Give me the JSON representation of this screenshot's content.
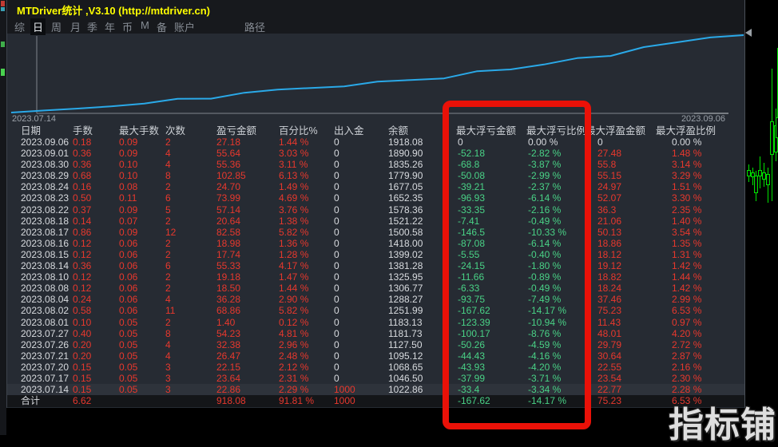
{
  "window": {
    "title": "MTDriver统计 ,V3.10 (http://mtdriver.cn)"
  },
  "menu": {
    "items": [
      "综",
      "日",
      "周",
      "月",
      "季",
      "年",
      "币",
      "M",
      "备",
      "账户",
      "路径"
    ],
    "active": "日"
  },
  "chart_data": {
    "type": "line",
    "x": [
      "2023.07.14",
      "2023.07.17",
      "2023.07.20",
      "2023.07.21",
      "2023.07.26",
      "2023.07.27",
      "2023.08.01",
      "2023.08.02",
      "2023.08.04",
      "2023.08.08",
      "2023.08.10",
      "2023.08.14",
      "2023.08.15",
      "2023.08.16",
      "2023.08.17",
      "2023.08.18",
      "2023.08.22",
      "2023.08.23",
      "2023.08.24",
      "2023.08.29",
      "2023.08.30",
      "2023.09.01",
      "2023.09.06"
    ],
    "y": [
      1022.86,
      1046.5,
      1068.65,
      1095.12,
      1127.5,
      1181.73,
      1183.13,
      1251.99,
      1288.27,
      1306.77,
      1325.95,
      1381.28,
      1399.02,
      1418.0,
      1500.58,
      1521.22,
      1578.36,
      1652.35,
      1677.05,
      1779.9,
      1835.26,
      1890.9,
      1918.08
    ],
    "x_start_label": "2023.07.14",
    "x_end_label": "2023.09.06",
    "ylim": [
      1022.86,
      1918.08
    ],
    "legend": [],
    "grid": false,
    "line_color": "#2aa9e8"
  },
  "table": {
    "headers": [
      "日期",
      "手数",
      "最大手数",
      "次数",
      "盈亏金额",
      "百分比%",
      "出入金",
      "余额",
      "最大浮亏金额",
      "最大浮亏比例",
      "最大浮盈金额",
      "最大浮盈比例"
    ],
    "rows": [
      [
        "2023.09.06",
        "0.18",
        "0.09",
        "2",
        "27.18",
        "1.44 %",
        "0",
        "1918.08",
        "0",
        "0.00 %",
        "0",
        "0.00 %"
      ],
      [
        "2023.09.01",
        "0.36",
        "0.09",
        "4",
        "55.64",
        "3.03 %",
        "0",
        "1890.90",
        "-52.18",
        "-2.82 %",
        "27.48",
        "1.48 %"
      ],
      [
        "2023.08.30",
        "0.36",
        "0.10",
        "4",
        "55.36",
        "3.11 %",
        "0",
        "1835.26",
        "-68.8",
        "-3.87 %",
        "55.8",
        "3.14 %"
      ],
      [
        "2023.08.29",
        "0.68",
        "0.10",
        "8",
        "102.85",
        "6.13 %",
        "0",
        "1779.90",
        "-50.08",
        "-2.99 %",
        "55.15",
        "3.29 %"
      ],
      [
        "2023.08.24",
        "0.16",
        "0.08",
        "2",
        "24.70",
        "1.49 %",
        "0",
        "1677.05",
        "-39.21",
        "-2.37 %",
        "24.97",
        "1.51 %"
      ],
      [
        "2023.08.23",
        "0.50",
        "0.11",
        "6",
        "73.99",
        "4.69 %",
        "0",
        "1652.35",
        "-96.93",
        "-6.14 %",
        "52.07",
        "3.30 %"
      ],
      [
        "2023.08.22",
        "0.37",
        "0.09",
        "5",
        "57.14",
        "3.76 %",
        "0",
        "1578.36",
        "-33.35",
        "-2.16 %",
        "36.3",
        "2.35 %"
      ],
      [
        "2023.08.18",
        "0.14",
        "0.07",
        "2",
        "20.64",
        "1.38 %",
        "0",
        "1521.22",
        "-7.41",
        "-0.49 %",
        "21.06",
        "1.40 %"
      ],
      [
        "2023.08.17",
        "0.86",
        "0.09",
        "12",
        "82.58",
        "5.82 %",
        "0",
        "1500.58",
        "-146.5",
        "-10.33 %",
        "50.13",
        "3.54 %"
      ],
      [
        "2023.08.16",
        "0.12",
        "0.06",
        "2",
        "18.98",
        "1.36 %",
        "0",
        "1418.00",
        "-87.08",
        "-6.14 %",
        "18.86",
        "1.35 %"
      ],
      [
        "2023.08.15",
        "0.12",
        "0.06",
        "2",
        "17.74",
        "1.28 %",
        "0",
        "1399.02",
        "-5.55",
        "-0.40 %",
        "18.12",
        "1.31 %"
      ],
      [
        "2023.08.14",
        "0.36",
        "0.06",
        "6",
        "55.33",
        "4.17 %",
        "0",
        "1381.28",
        "-24.15",
        "-1.80 %",
        "19.12",
        "1.42 %"
      ],
      [
        "2023.08.10",
        "0.12",
        "0.06",
        "2",
        "19.18",
        "1.47 %",
        "0",
        "1325.95",
        "-11.66",
        "-0.89 %",
        "18.82",
        "1.44 %"
      ],
      [
        "2023.08.08",
        "0.12",
        "0.06",
        "2",
        "18.50",
        "1.44 %",
        "0",
        "1306.77",
        "-6.33",
        "-0.49 %",
        "18.24",
        "1.42 %"
      ],
      [
        "2023.08.04",
        "0.24",
        "0.06",
        "4",
        "36.28",
        "2.90 %",
        "0",
        "1288.27",
        "-93.75",
        "-7.49 %",
        "37.46",
        "2.99 %"
      ],
      [
        "2023.08.02",
        "0.58",
        "0.06",
        "11",
        "68.86",
        "5.82 %",
        "0",
        "1251.99",
        "-167.62",
        "-14.17 %",
        "75.23",
        "6.53 %"
      ],
      [
        "2023.08.01",
        "0.10",
        "0.05",
        "2",
        "1.40",
        "0.12 %",
        "0",
        "1183.13",
        "-123.39",
        "-10.94 %",
        "11.43",
        "0.97 %"
      ],
      [
        "2023.07.27",
        "0.40",
        "0.05",
        "8",
        "54.23",
        "4.81 %",
        "0",
        "1181.73",
        "-100.17",
        "-8.76 %",
        "48.01",
        "4.20 %"
      ],
      [
        "2023.07.26",
        "0.20",
        "0.05",
        "4",
        "32.38",
        "2.96 %",
        "0",
        "1127.50",
        "-50.26",
        "-4.59 %",
        "29.79",
        "2.72 %"
      ],
      [
        "2023.07.21",
        "0.20",
        "0.05",
        "4",
        "26.47",
        "2.48 %",
        "0",
        "1095.12",
        "-44.43",
        "-4.16 %",
        "30.64",
        "2.87 %"
      ],
      [
        "2023.07.20",
        "0.15",
        "0.05",
        "3",
        "22.15",
        "2.12 %",
        "0",
        "1068.65",
        "-43.93",
        "-4.20 %",
        "22.55",
        "2.16 %"
      ],
      [
        "2023.07.17",
        "0.15",
        "0.05",
        "3",
        "23.64",
        "2.31 %",
        "0",
        "1046.50",
        "-37.99",
        "-3.71 %",
        "23.54",
        "2.30 %"
      ],
      [
        "2023.07.14",
        "0.15",
        "0.05",
        "3",
        "22.86",
        "2.29 %",
        "1000",
        "1022.86",
        "-33.4",
        "-3.34 %",
        "22.77",
        "2.28 %"
      ]
    ],
    "total": [
      "合计",
      "6.62",
      "",
      "",
      "918.08",
      "91.81 %",
      "1000",
      "",
      "-167.62",
      "-14.17 %",
      "75.23",
      "6.53 %"
    ]
  },
  "annotation": {
    "shape": "rectangle",
    "color": "#ea1108",
    "highlights": [
      "最大浮亏金额",
      "最大浮亏比例"
    ]
  },
  "watermark": "指标铺",
  "colors": {
    "panel_bg": "#262b33",
    "titlebar_bg": "#17191d",
    "title_text": "#ffff00",
    "value_red": "#e8382d",
    "value_green": "#49d286",
    "value_white": "#d8dbdf",
    "equity_line": "#2aa9e8",
    "axis": "#80868e",
    "candle_green": "#00e400",
    "annotation_red": "#ea1108"
  }
}
